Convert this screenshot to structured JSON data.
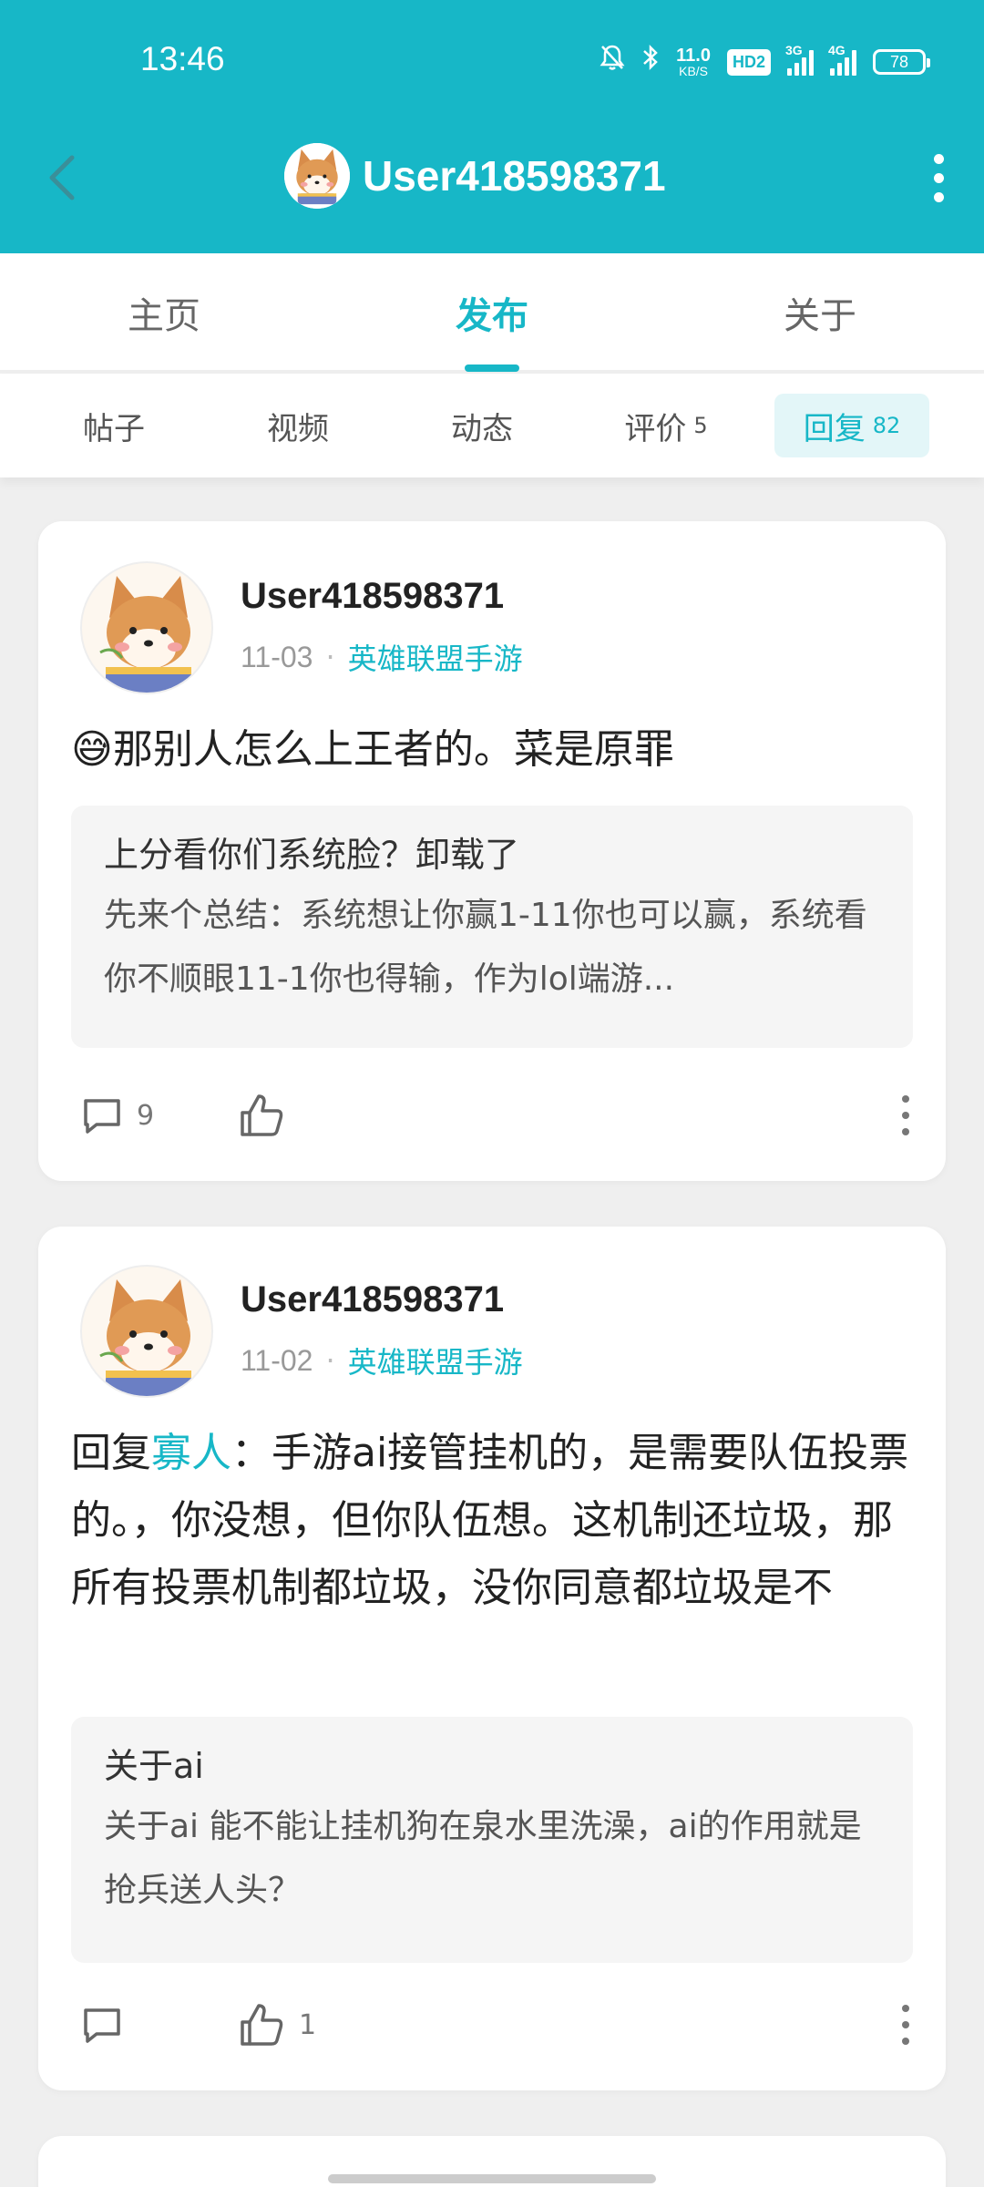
{
  "status_bar": {
    "time": "13:46",
    "net_speed": "11.0",
    "net_speed_unit": "KB/S",
    "hd_badge": "HD2",
    "signal1": "3G",
    "signal2": "4G",
    "battery": "78"
  },
  "header": {
    "title": "User418598371",
    "accent_color": "#17b7c7"
  },
  "main_tabs": [
    {
      "label": "主页"
    },
    {
      "label": "发布"
    },
    {
      "label": "关于"
    }
  ],
  "sub_tabs": [
    {
      "label": "帖子",
      "count": ""
    },
    {
      "label": "视频",
      "count": ""
    },
    {
      "label": "动态",
      "count": ""
    },
    {
      "label": "评价",
      "count": "5"
    },
    {
      "label": "回复",
      "count": "82"
    }
  ],
  "posts": [
    {
      "username": "User418598371",
      "date": "11-03",
      "separator": "·",
      "forum": "英雄联盟手游",
      "text": "😅那别人怎么上王者的。菜是原罪",
      "quote_title": "上分看你们系统脸？卸载了",
      "quote_body": "先来个总结：系统想让你赢1-11你也可以赢，系统看你不顺眼11-1你也得输，作为lol端游...",
      "comments": "9",
      "likes": ""
    },
    {
      "username": "User418598371",
      "date": "11-02",
      "separator": "·",
      "forum": "英雄联盟手游",
      "text_prefix": "回复",
      "mention": "寡人",
      "text": "：手游ai接管挂机的，是需要队伍投票的。，你没想，但你队伍想。这机制还垃圾，那所有投票机制都垃圾，没你同意都垃圾是不",
      "quote_title": "关于ai",
      "quote_body": "关于ai 能不能让挂机狗在泉水里洗澡，ai的作用就是抢兵送人头？",
      "comments": "",
      "likes": "1"
    }
  ]
}
